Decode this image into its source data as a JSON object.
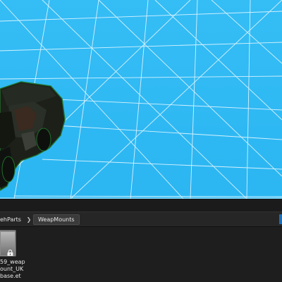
{
  "breadcrumb": {
    "items": [
      {
        "label": "ehParts"
      },
      {
        "label": "WeapMounts"
      }
    ]
  },
  "asset": {
    "line1": "59_weap",
    "line2": "ount_UK",
    "line3": "base.et",
    "icon": "lock-icon"
  },
  "colors": {
    "sky": "#2fb9f4",
    "grid": "#e8f8ff",
    "panel": "#1e1e1e",
    "accent": "#1b6fb5"
  }
}
